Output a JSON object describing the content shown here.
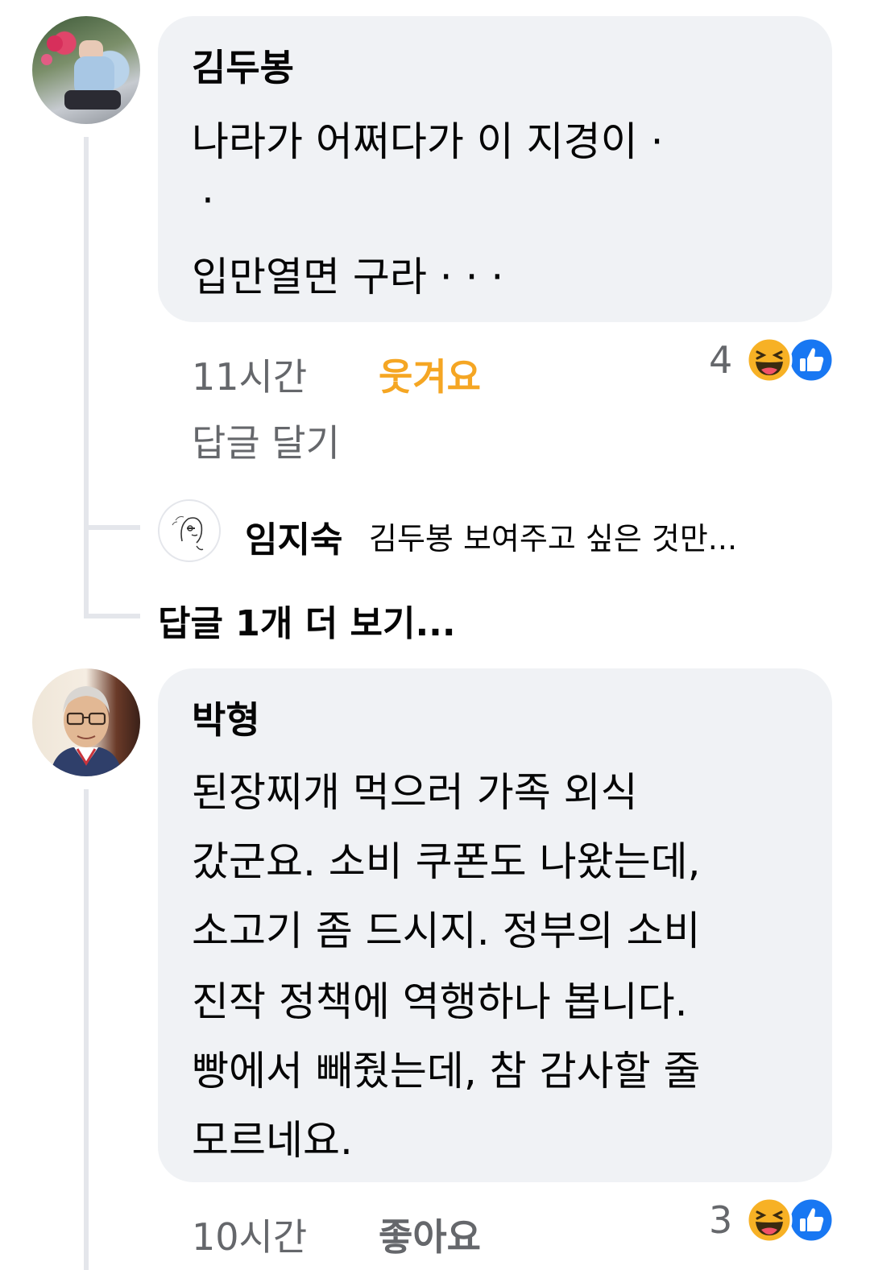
{
  "comments": [
    {
      "author": "김두봉",
      "lines": [
        "나라가  어쩌다가  이 지경이 ·",
        "·",
        "입만열면 구라 ·  ·  ·"
      ],
      "time": "11시간",
      "reaction_label": "웃겨요",
      "reaction_color": "#f5a623",
      "reply_label": "답글 달기",
      "reaction_count": "4",
      "reactions": [
        "haha-icon",
        "like-icon"
      ]
    },
    {
      "author": "박형",
      "lines": [
        "된장찌개 먹으러 가족 외식",
        "갔군요. 소비 쿠폰도 나왔는데,",
        "소고기 좀 드시지. 정부의 소비",
        "진작 정책에 역행하나 봅니다.",
        "빵에서 빼줬는데, 참 감사할 줄",
        "모르네요."
      ],
      "time": "10시간",
      "reaction_label": "좋아요",
      "reaction_count": "3",
      "reactions": [
        "haha-icon",
        "like-icon"
      ]
    }
  ],
  "reply_preview": {
    "author": "임지숙",
    "text": "김두봉 보여주고 싶은 것만..."
  },
  "more_replies": "답글 1개 더 보기...",
  "colors": {
    "bubble": "#f0f2f5",
    "meta": "#65676b",
    "haha": "#f7b125",
    "like": "#1877f2"
  }
}
